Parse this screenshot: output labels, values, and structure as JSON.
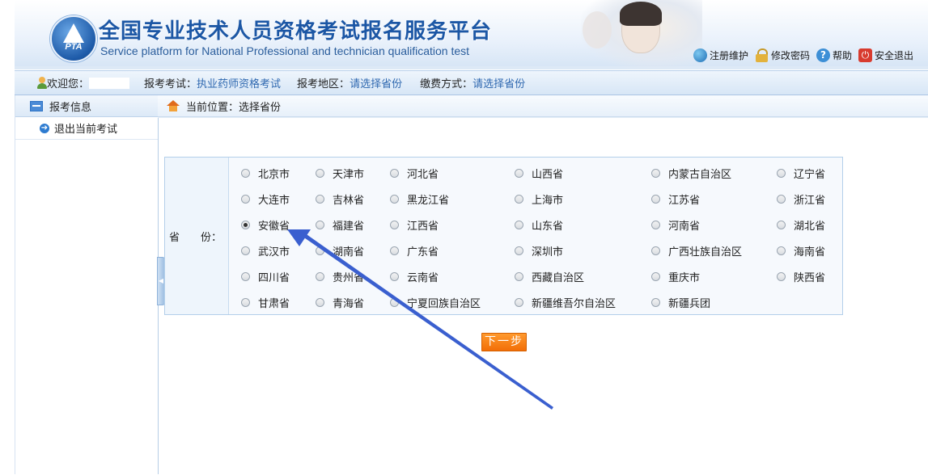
{
  "header": {
    "logo_text": "PTA",
    "title_cn": "全国专业技术人员资格考试报名服务平台",
    "title_en": "Service platform for National Professional and technician qualification test",
    "links": [
      "注册维护",
      "修改密码",
      "帮助",
      "安全退出"
    ]
  },
  "infobar": {
    "welcome_label": "欢迎您：",
    "exam_label": "报考考试：",
    "exam_value": "执业药师资格考试",
    "region_label": "报考地区：",
    "region_value": "请选择省份",
    "pay_label": "缴费方式：",
    "pay_value": "请选择省份"
  },
  "sidebar": {
    "header": "报考信息",
    "items": [
      {
        "label": "退出当前考试"
      }
    ]
  },
  "breadcrumb": {
    "text": "当前位置：选择省份"
  },
  "form": {
    "province_label": "省　　份：",
    "selected": "安徽省",
    "provinces": [
      [
        "北京市",
        "天津市",
        "河北省",
        "山西省",
        "内蒙古自治区",
        "辽宁省"
      ],
      [
        "大连市",
        "吉林省",
        "黑龙江省",
        "上海市",
        "江苏省",
        "浙江省"
      ],
      [
        "安徽省",
        "福建省",
        "江西省",
        "山东省",
        "河南省",
        "湖北省"
      ],
      [
        "武汉市",
        "湖南省",
        "广东省",
        "深圳市",
        "广西壮族自治区",
        "海南省"
      ],
      [
        "四川省",
        "贵州省",
        "云南省",
        "西藏自治区",
        "重庆市",
        "陕西省"
      ],
      [
        "甘肃省",
        "青海省",
        "宁夏回族自治区",
        "新疆维吾尔自治区",
        "新疆兵团"
      ]
    ],
    "next_button": "下一步"
  },
  "colors": {
    "accent_blue": "#2f68b0",
    "button_orange": "#f26e07",
    "annotation_arrow": "#3a5fcf"
  }
}
